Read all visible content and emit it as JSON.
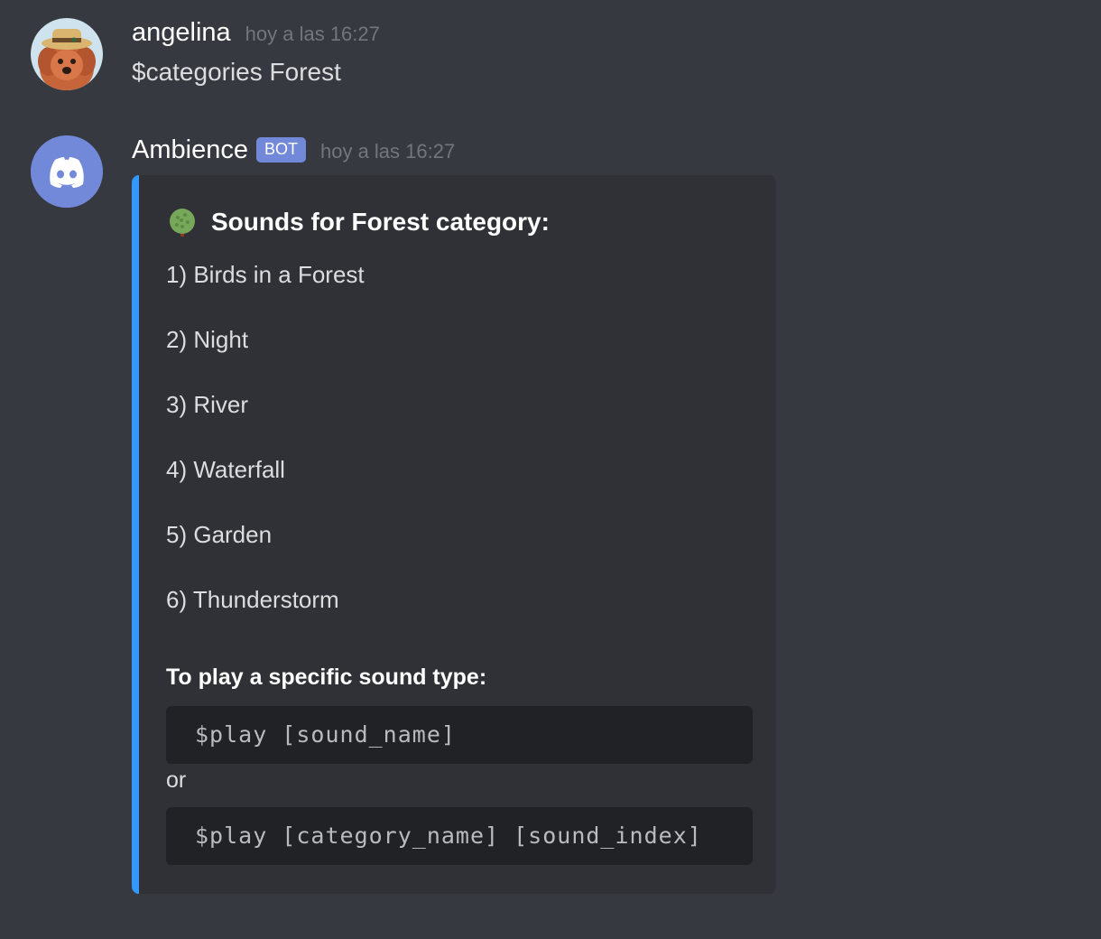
{
  "messages": [
    {
      "username": "angelina",
      "timestamp": "hoy a las 16:27",
      "content": "$categories Forest"
    },
    {
      "username": "Ambience",
      "bot_tag": "BOT",
      "timestamp": "hoy a las 16:27",
      "embed": {
        "accent_color": "#3498ff",
        "title_icon": "tree-emoji",
        "title": "Sounds for Forest category:",
        "sounds": [
          "1) Birds in a Forest",
          "2) Night",
          "3) River",
          "4) Waterfall",
          "5) Garden",
          "6) Thunderstorm"
        ],
        "usage_heading": "To play a specific sound type:",
        "code_1": "$play [sound_name]",
        "or_text": "or",
        "code_2": "$play [category_name] [sound_index]"
      }
    }
  ],
  "colors": {
    "background": "#36393f",
    "embed_background": "#2f3136",
    "bot_tag": "#7289da",
    "discord_blurple": "#7289da"
  }
}
